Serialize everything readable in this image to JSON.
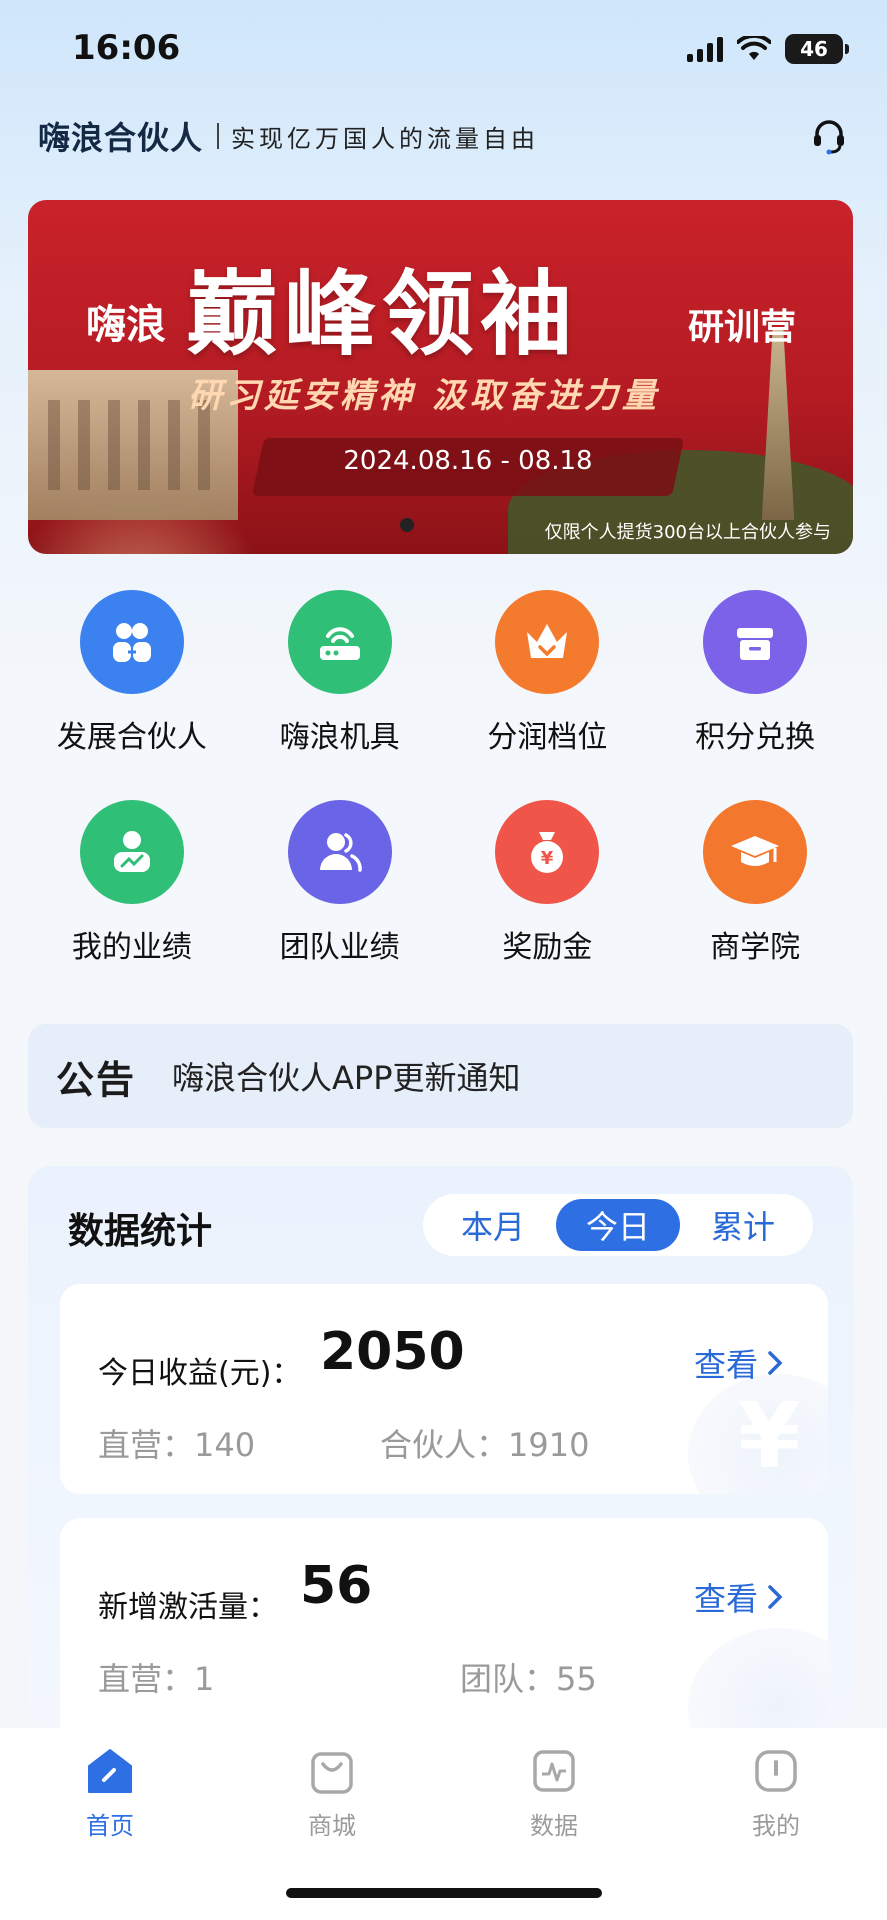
{
  "status_bar": {
    "time": "16:06",
    "network": "46"
  },
  "header": {
    "brand": "嗨浪合伙人",
    "slogan": "实现亿万国人的流量自由",
    "support_icon": "headset-icon"
  },
  "banner": {
    "prefix": "嗨浪",
    "title": "巅峰领袖",
    "suffix": "研训营",
    "subtitle": "研习延安精神 汲取奋进力量",
    "dates": "2024.08.16 - 08.18",
    "note": "仅限个人提货300台以上合伙人参与"
  },
  "grid": [
    {
      "label": "发展合伙人",
      "icon": "partners-icon",
      "color": "#3b82f0"
    },
    {
      "label": "嗨浪机具",
      "icon": "router-icon",
      "color": "#2fbf77"
    },
    {
      "label": "分润档位",
      "icon": "crown-icon",
      "color": "#f47a2e"
    },
    {
      "label": "积分兑换",
      "icon": "gift-box-icon",
      "color": "#7b62e8"
    },
    {
      "label": "我的业绩",
      "icon": "performance-icon",
      "color": "#2fbf77"
    },
    {
      "label": "团队业绩",
      "icon": "team-icon",
      "color": "#6a64e6"
    },
    {
      "label": "奖励金",
      "icon": "money-bag-icon",
      "color": "#f0554a"
    },
    {
      "label": "商学院",
      "icon": "graduation-cap-icon",
      "color": "#f4772e"
    }
  ],
  "notice": {
    "tag": "公告",
    "text": "嗨浪合伙人APP更新通知"
  },
  "stats": {
    "title": "数据统计",
    "tabs": [
      "本月",
      "今日",
      "累计"
    ],
    "active_tab": "今日",
    "income": {
      "label": "今日收益(元)：",
      "value": "2050",
      "link": "查看",
      "direct_label": "直营：140",
      "partner_label": "合伙人：1910"
    },
    "activation": {
      "label": "新增激活量：",
      "value": "56",
      "link": "查看",
      "direct_label": "直营：1",
      "team_label": "团队：55"
    }
  },
  "tabbar": [
    {
      "label": "首页",
      "icon": "home-icon",
      "active": true
    },
    {
      "label": "商城",
      "icon": "shopping-bag-icon",
      "active": false
    },
    {
      "label": "数据",
      "icon": "chart-icon",
      "active": false
    },
    {
      "label": "我的",
      "icon": "profile-icon",
      "active": false
    }
  ]
}
